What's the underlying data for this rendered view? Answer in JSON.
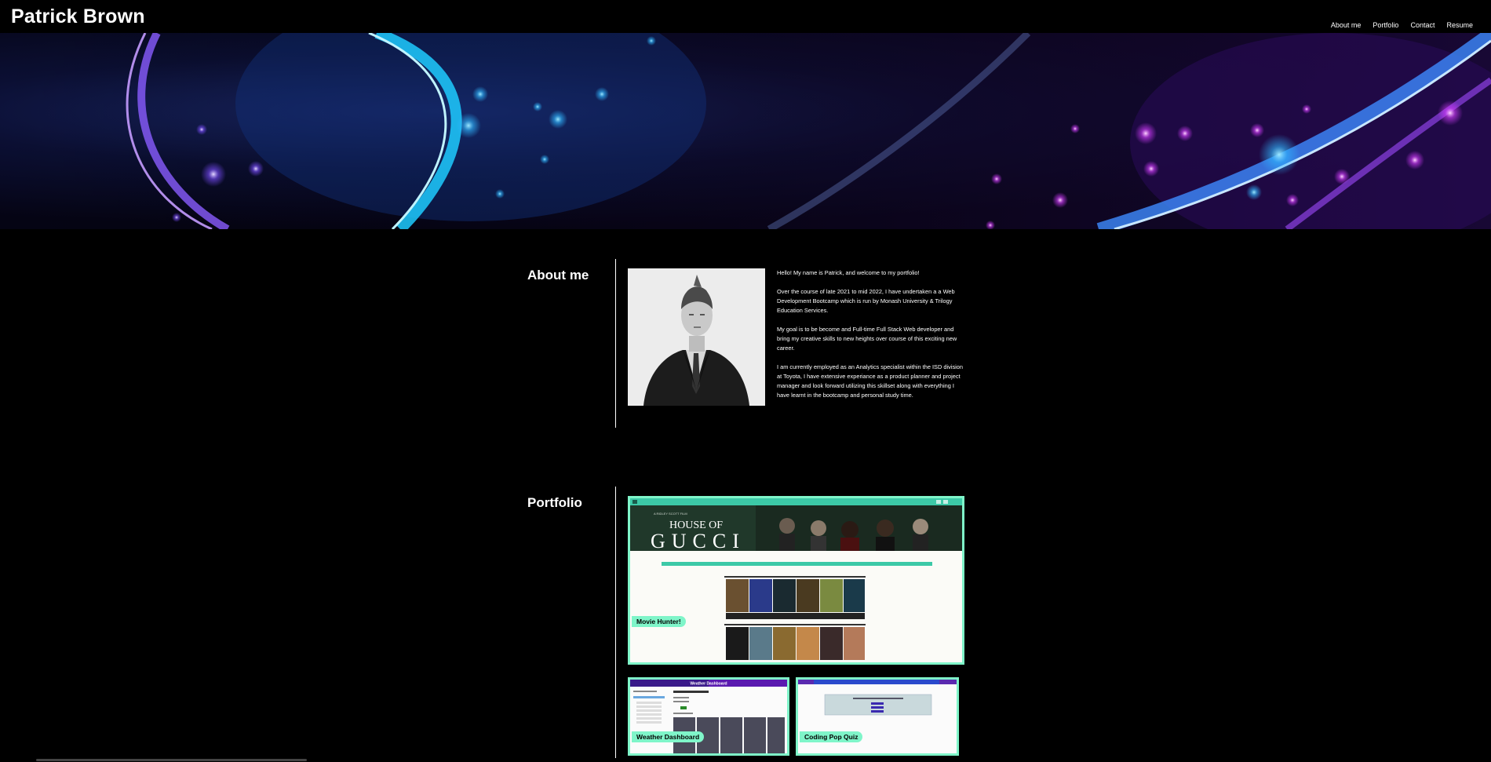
{
  "header": {
    "title": "Patrick Brown",
    "nav": [
      "About me",
      "Portfolio",
      "Contact",
      "Resume"
    ]
  },
  "about": {
    "heading": "About me",
    "paragraphs": [
      "Hello! My name is Patrick, and welcome to my portfolio!",
      "Over the course of late 2021 to mid 2022, I have undertaken a a Web Development Bootcamp which is run by Monash University & Trilogy Education Services.",
      "My goal is to be become and Full-time Full Stack Web developer and bring my creative skills to new heights over course of this exciting new career.",
      "I am currently employed as an Analytics specialist within the ISD division at Toyota, I have extensive experiance as a product planner and project manager and look forward utilizing this skillset along with everything I have learnt in the bootcamp and personal study time."
    ]
  },
  "portfolio": {
    "heading": "Portfolio",
    "projects": [
      {
        "label": "Movie Hunter!",
        "screenshot_text": {
          "hero_small": "A RIDLEY SCOTT FILM",
          "hero_line1": "HOUSE OF",
          "hero_line2": "GUCCI"
        }
      },
      {
        "label": "Weather Dashboard",
        "screenshot_text": {
          "title": "Weather Dashboard"
        }
      },
      {
        "label": "Coding Pop Quiz",
        "screenshot_text": {}
      }
    ]
  },
  "colors": {
    "background": "#000000",
    "accent": "#7ff5c9",
    "text": "#ffffff"
  }
}
